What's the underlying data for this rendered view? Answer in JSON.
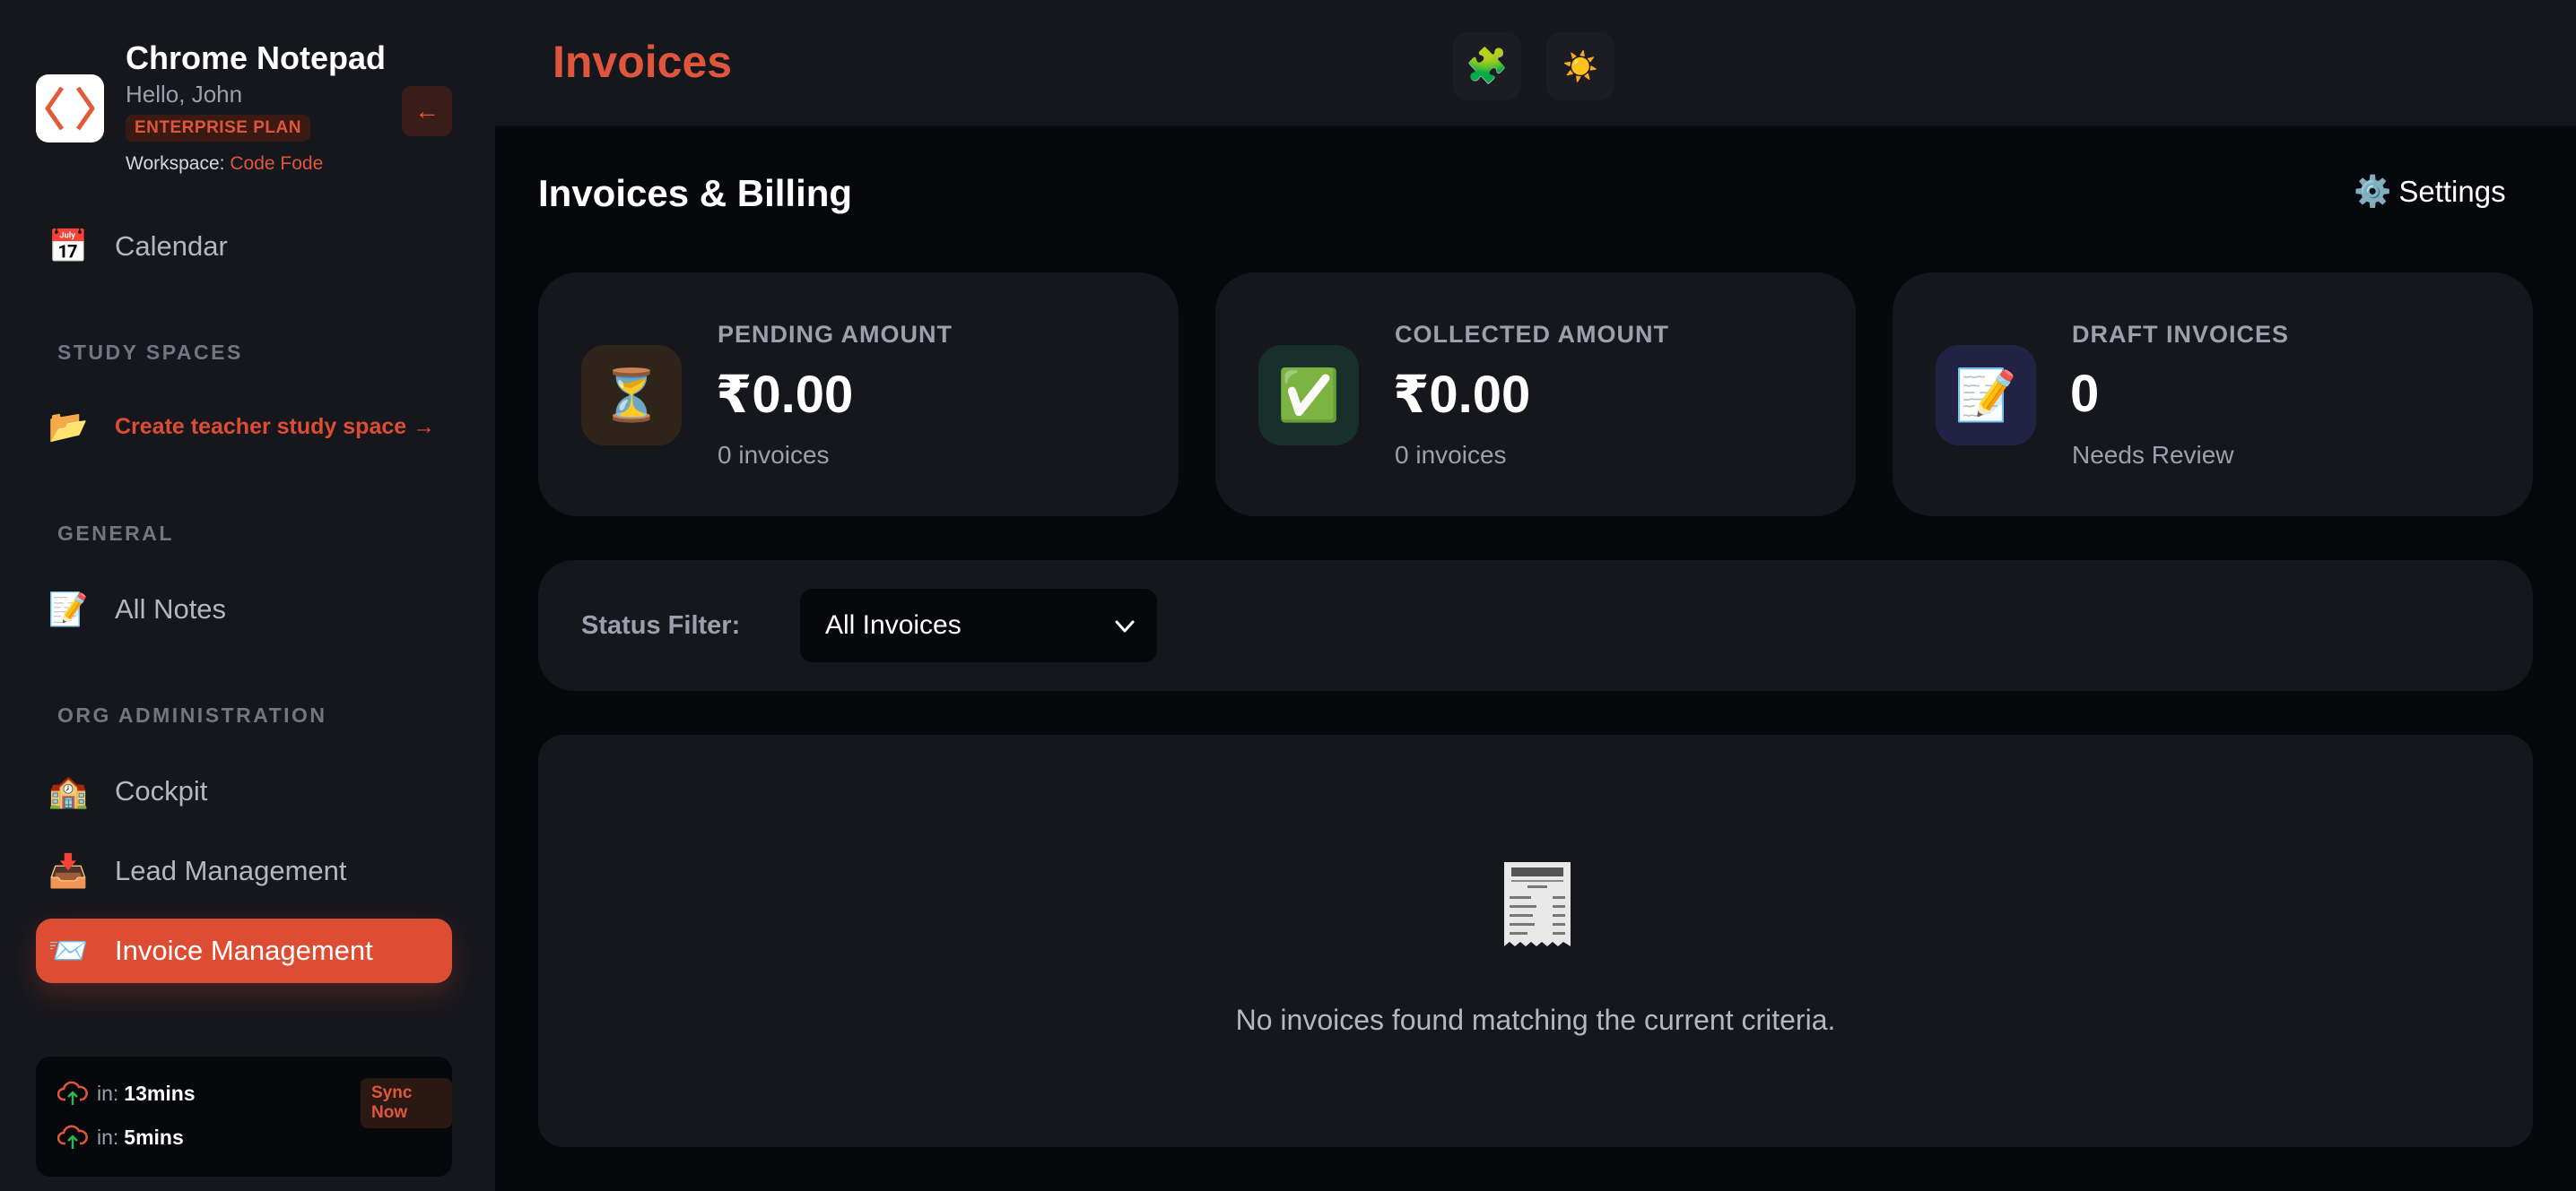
{
  "app": {
    "title": "Chrome Notepad",
    "greeting": "Hello, John",
    "plan": "ENTERPRISE PLAN",
    "workspace_label": "Workspace:",
    "workspace_name": "Code Fode",
    "collapse_label": "←"
  },
  "sidebar": {
    "calendar": {
      "label": "Calendar",
      "icon": "📅"
    },
    "study_spaces_label": "STUDY SPACES",
    "create_space": {
      "label": "Create teacher study space →",
      "icon": "📂"
    },
    "general_label": "GENERAL",
    "all_notes": {
      "label": "All Notes",
      "icon": "📝"
    },
    "org_admin_label": "ORG ADMINISTRATION",
    "cockpit": {
      "label": "Cockpit",
      "icon": "🏫"
    },
    "lead_management": {
      "label": "Lead Management",
      "icon": "📥"
    },
    "invoice_management": {
      "label": "Invoice Management",
      "icon": "📨"
    }
  },
  "sync": {
    "row1_prefix": "in:",
    "row1_time": "13mins",
    "row2_prefix": "in:",
    "row2_time": "5mins",
    "sync_now": "Sync Now"
  },
  "header": {
    "title": "Invoices",
    "extensions_icon": "🧩",
    "theme_icon": "☀️"
  },
  "main": {
    "heading": "Invoices & Billing",
    "settings_icon": "⚙️",
    "settings_label": "Settings",
    "cards": [
      {
        "label": "PENDING AMOUNT",
        "value": "₹0.00",
        "sub": "0 invoices",
        "icon": "⏳"
      },
      {
        "label": "COLLECTED AMOUNT",
        "value": "₹0.00",
        "sub": "0 invoices",
        "icon": "✅"
      },
      {
        "label": "DRAFT INVOICES",
        "value": "0",
        "sub": "Needs Review",
        "icon": "📝"
      }
    ],
    "filter": {
      "label": "Status Filter:",
      "selected": "All Invoices"
    },
    "empty_message": "No invoices found matching the current criteria."
  },
  "colors": {
    "accent": "#dd4d33",
    "sidebar_bg": "#16171d",
    "page_bg": "#07080c"
  }
}
